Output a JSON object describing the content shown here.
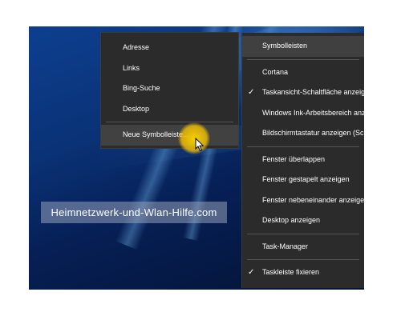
{
  "watermark": "Heimnetzwerk-und-Wlan-Hilfe.com",
  "submenu": {
    "items": [
      "Adresse",
      "Links",
      "Bing-Suche",
      "Desktop"
    ],
    "new_toolbar": "Neue Symbolleiste..."
  },
  "mainmenu": {
    "items": [
      {
        "label": "Symbolleisten",
        "checked": false
      },
      {
        "label": "Cortana",
        "checked": false
      },
      {
        "label": "Taskansicht-Schaltfläche anzeigen",
        "checked": true
      },
      {
        "label": "Windows Ink-Arbeitsbereich anzeigen",
        "checked": false
      },
      {
        "label": "Bildschirmtastatur anzeigen (Schaltfläche)",
        "checked": false
      },
      {
        "label": "Fenster überlappen",
        "checked": false
      },
      {
        "label": "Fenster gestapelt anzeigen",
        "checked": false
      },
      {
        "label": "Fenster nebeneinander anzeigen",
        "checked": false
      },
      {
        "label": "Desktop anzeigen",
        "checked": false
      },
      {
        "label": "Task-Manager",
        "checked": false
      },
      {
        "label": "Taskleiste fixieren",
        "checked": true
      }
    ],
    "check_glyph": "✓"
  },
  "colors": {
    "menu_bg": "#2b2b2b",
    "highlight": "#414141",
    "cursor_glow": "#ffd700"
  }
}
